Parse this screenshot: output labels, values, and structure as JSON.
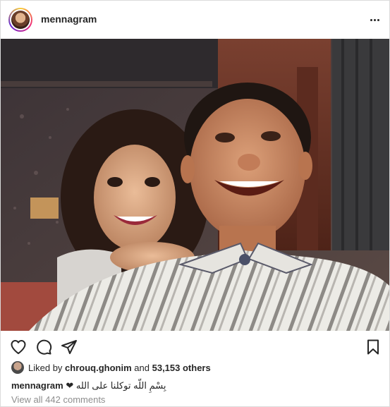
{
  "post": {
    "username": "mennagram",
    "more_icon": "more-horizontal-icon"
  },
  "actions": {
    "like_icon": "heart-icon",
    "comment_icon": "comment-icon",
    "share_icon": "paper-plane-icon",
    "save_icon": "bookmark-icon"
  },
  "likes": {
    "prefix": "Liked by",
    "liker": "chrouq.ghonim",
    "middle": "and",
    "count_text": "53,153 others"
  },
  "caption": {
    "username": "mennagram",
    "text": "❤ بِسْمِ اللّه توكلنا على الله"
  },
  "comments": {
    "view_all": "View all 442 comments"
  },
  "colors": {
    "text": "#262626",
    "secondary": "#8e8e8e",
    "border": "#dbdbdb"
  }
}
